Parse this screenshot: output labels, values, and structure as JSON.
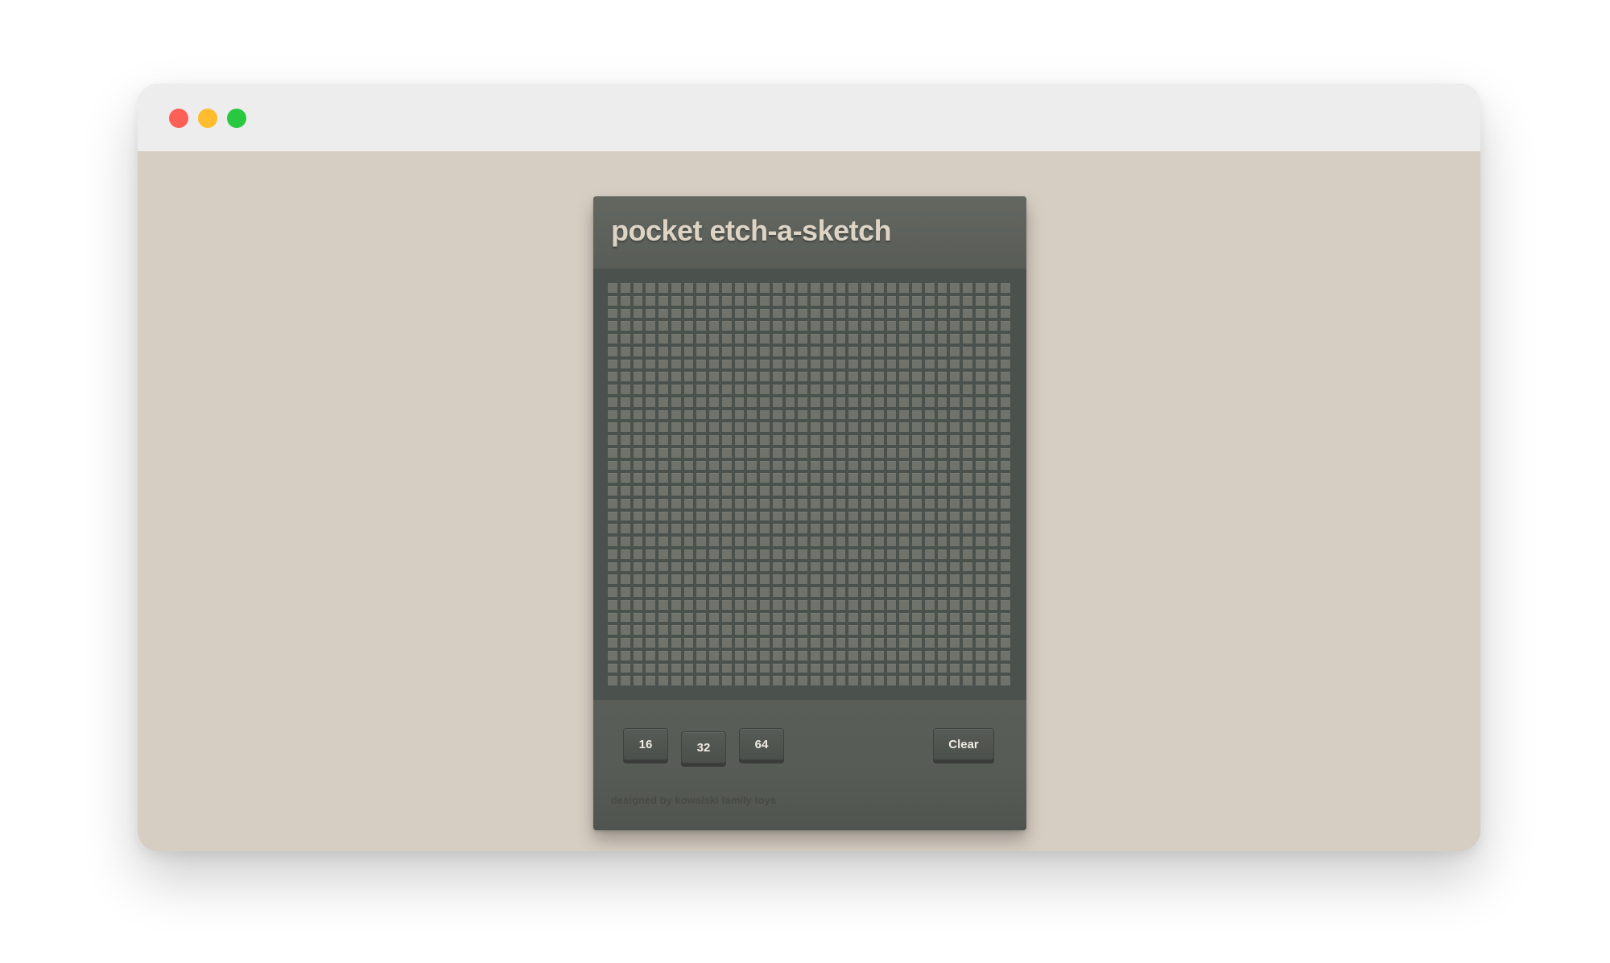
{
  "window": {
    "controls": [
      "close",
      "minimize",
      "maximize"
    ]
  },
  "app": {
    "title": "pocket etch-a-sketch",
    "grid_size": 32,
    "colors": {
      "page_background": "#d7cec3",
      "device_body": "#575b55",
      "screen": "#4b514c",
      "cell": "#6f736c",
      "title_text": "#ddd4c6"
    }
  },
  "controls": {
    "size_buttons": [
      "16",
      "32",
      "64"
    ],
    "selected_size": "32",
    "clear_label": "Clear"
  },
  "footer": {
    "credit": "designed by kowalski family toys"
  }
}
